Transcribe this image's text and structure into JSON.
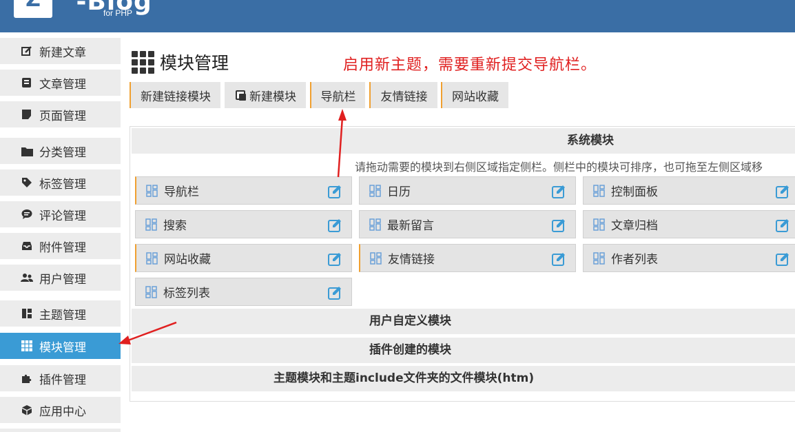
{
  "header": {
    "logo_letter": "Z",
    "logo_text": "Z-Blog",
    "logo_sub": "for PHP"
  },
  "sidebar": {
    "items": [
      {
        "label": "新建文章",
        "icon": "edit-icon"
      },
      {
        "label": "文章管理",
        "icon": "article-icon"
      },
      {
        "label": "页面管理",
        "icon": "page-icon"
      },
      {
        "label": "分类管理",
        "icon": "folder-icon"
      },
      {
        "label": "标签管理",
        "icon": "tag-icon"
      },
      {
        "label": "评论管理",
        "icon": "comment-icon"
      },
      {
        "label": "附件管理",
        "icon": "inbox-icon"
      },
      {
        "label": "用户管理",
        "icon": "users-icon"
      },
      {
        "label": "主题管理",
        "icon": "theme-icon"
      },
      {
        "label": "模块管理",
        "icon": "grid-icon",
        "active": true
      },
      {
        "label": "插件管理",
        "icon": "puzzle-icon"
      },
      {
        "label": "应用中心",
        "icon": "cube-icon"
      }
    ]
  },
  "main": {
    "title": "模块管理",
    "notice": "启用新主题，需要重新提交导航栏。",
    "tabs": [
      {
        "label": "新建链接模块"
      },
      {
        "label": "新建模块"
      },
      {
        "label": "导航栏"
      },
      {
        "label": "友情链接"
      },
      {
        "label": "网站收藏"
      }
    ],
    "sections": {
      "system": "系统模块",
      "hint": "请拖动需要的模块到右侧区域指定侧栏。侧栏中的模块可排序，也可拖至左侧区域移",
      "user_defined": "用户自定义模块",
      "plugin_created": "插件创建的模块",
      "theme_modules": "主题模块和主题include文件夹的文件模块(htm)"
    },
    "modules": [
      {
        "label": "导航栏"
      },
      {
        "label": "日历"
      },
      {
        "label": "控制面板"
      },
      {
        "label": "搜索"
      },
      {
        "label": "最新留言"
      },
      {
        "label": "文章归档"
      },
      {
        "label": "网站收藏"
      },
      {
        "label": "友情链接"
      },
      {
        "label": "作者列表"
      },
      {
        "label": "标签列表"
      }
    ]
  },
  "colors": {
    "header_bg": "#3a6ea5",
    "active_nav": "#3a9bd5",
    "notice_red": "#e02020",
    "accent_orange": "#f0a030",
    "edit_blue": "#3a9bd5"
  }
}
